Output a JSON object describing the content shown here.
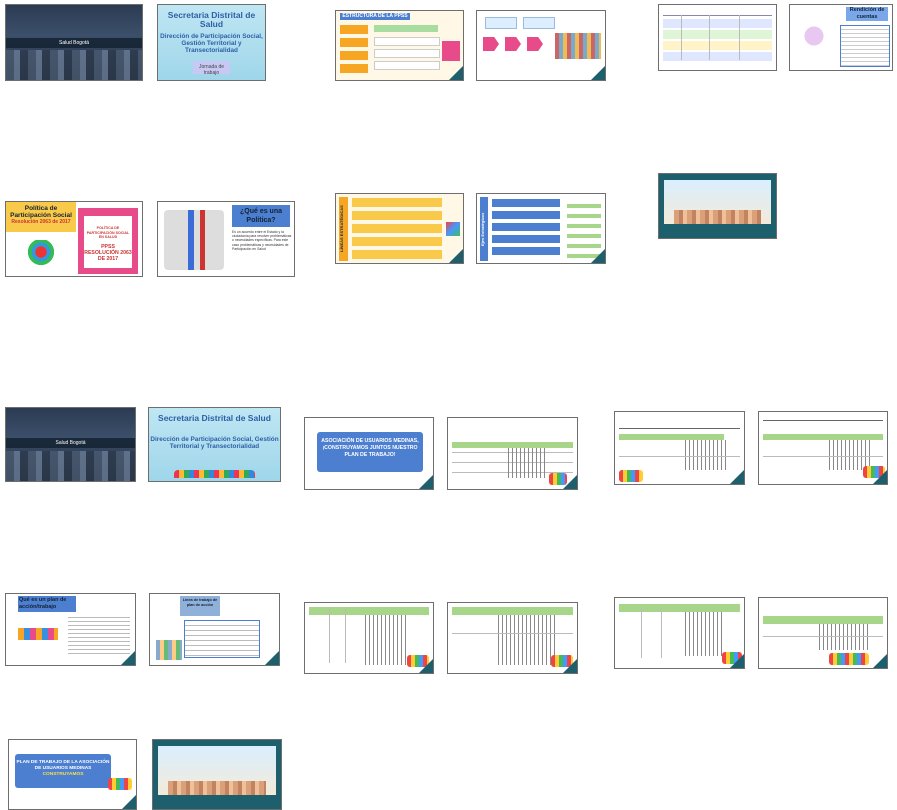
{
  "slides": {
    "s1_logo": "Salud Bogotá",
    "s2_title": "Secretaria Distrital de Salud",
    "s2_sub": "Dirección de Participación Social, Gestión Territorial y Transectorialidad",
    "s2_strip": "Jornada de trabajo",
    "s3_title": "ESTRUCTURA DE LA PPSS",
    "s6_title": "Rendición de cuentas",
    "s7_title": "Política de Participación Social",
    "s7_sub": "Resolución 2063 de 2017",
    "s7_right": "POLÍTICA DE PARTICIPACIÓN SOCIAL EN SALUD",
    "s7_right2": "PPSS RESOLUCIÓN 2063 DE 2017",
    "s8_title": "¿Qué es una Política?",
    "s8_body": "Es un acuerdo entre el Estado y la ciudadanía para resolver problemáticas o necesidades específicas. Para este caso problemáticas y necesidades de Participación en Salud",
    "s9_label": "LÍNEAS ESTRATÉGICAS",
    "s10_label": "Ejes Estratégicos",
    "gracias": "Gracias",
    "s13_title": "Secretaria Distrital de Salud",
    "s13_sub": "Dirección de Participación Social, Gestión Territorial y Transectorialidad",
    "s14_title": "ASOCIACIÓN DE USUARIOS MEDINAS, ¡CONSTRUYAMOS JUNTOS NUESTRO PLAN DE TRABAJO!",
    "s18_title": "Qué es un plan de acción/trabajo",
    "s19_title": "Línea de trabajo de plan de acción",
    "s24_title": "PLAN DE TRABAJO DE LA ASOCIACIÓN DE USUARIOS MEDINAS",
    "s24_title2": "CONSTRUYAMOS"
  },
  "colors": {
    "teal": "#1e5f6d",
    "title_blue": "#2d5fa6",
    "box_blue": "#4d7fd0"
  }
}
